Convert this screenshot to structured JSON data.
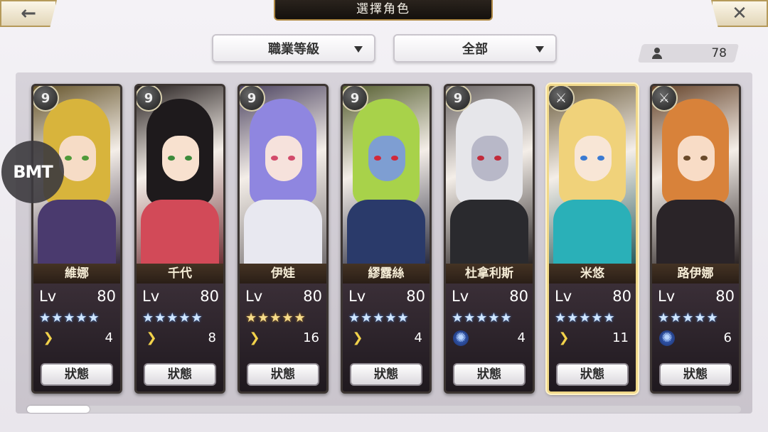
{
  "header": {
    "title": "選擇角色",
    "back_icon": "←",
    "close_icon": "✕"
  },
  "filters": {
    "class_filter": "職業等級",
    "type_filter": "全部"
  },
  "roster_count": "78",
  "watermark": "BMT",
  "characters": [
    {
      "name": "維娜",
      "lv_label": "Lv",
      "level": "80",
      "stars": "★★★★★",
      "star_color": "blue",
      "element": "wind",
      "element_icon": "❯",
      "count": "4",
      "status": "狀態",
      "badge": "9",
      "selected": false,
      "palette": {
        "hair": "#d8b43c",
        "skin": "#f6dcc6",
        "eye": "#4f9a3a",
        "body": "#4a3a6e"
      }
    },
    {
      "name": "千代",
      "lv_label": "Lv",
      "level": "80",
      "stars": "★★★★★",
      "star_color": "blue",
      "element": "wind",
      "element_icon": "❯",
      "count": "8",
      "status": "狀態",
      "badge": "9",
      "selected": false,
      "palette": {
        "hair": "#1e1a1c",
        "skin": "#f8e1cf",
        "eye": "#3c8a3a",
        "body": "#d24a58"
      }
    },
    {
      "name": "伊娃",
      "lv_label": "Lv",
      "level": "80",
      "stars": "★★★★★",
      "star_color": "gold",
      "element": "wind",
      "element_icon": "❯",
      "count": "16",
      "status": "狀態",
      "badge": "9",
      "selected": false,
      "palette": {
        "hair": "#8f86e0",
        "skin": "#f6e2dc",
        "eye": "#d24a6a",
        "body": "#e8e8f0"
      }
    },
    {
      "name": "繆露絲",
      "lv_label": "Lv",
      "level": "80",
      "stars": "★★★★★",
      "star_color": "blue",
      "element": "wind",
      "element_icon": "❯",
      "count": "4",
      "status": "狀態",
      "badge": "9",
      "selected": false,
      "palette": {
        "hair": "#a8d24a",
        "skin": "#7e9ed2",
        "eye": "#d2283a",
        "body": "#2a3a6a"
      }
    },
    {
      "name": "杜拿利斯",
      "lv_label": "Lv",
      "level": "80",
      "stars": "★★★★★",
      "star_color": "blue",
      "element": "water",
      "element_icon": "✺",
      "count": "4",
      "status": "狀態",
      "badge": "9",
      "selected": false,
      "palette": {
        "hair": "#e6e6ea",
        "skin": "#b8b8c8",
        "eye": "#c22a3a",
        "body": "#2a2a2e"
      }
    },
    {
      "name": "米悠",
      "lv_label": "Lv",
      "level": "80",
      "stars": "★★★★★",
      "star_color": "blue",
      "element": "wind",
      "element_icon": "❯",
      "count": "11",
      "status": "狀態",
      "badge": "⚔",
      "selected": true,
      "palette": {
        "hair": "#f0d27a",
        "skin": "#f8e6d6",
        "eye": "#3a7ad2",
        "body": "#2ab0b8"
      }
    },
    {
      "name": "路伊娜",
      "lv_label": "Lv",
      "level": "80",
      "stars": "★★★★★",
      "star_color": "blue",
      "element": "water",
      "element_icon": "✺",
      "count": "6",
      "status": "狀態",
      "badge": "⚔",
      "selected": false,
      "palette": {
        "hair": "#d8823a",
        "skin": "#f8dcc6",
        "eye": "#6a4a2a",
        "body": "#2a2428"
      }
    }
  ]
}
